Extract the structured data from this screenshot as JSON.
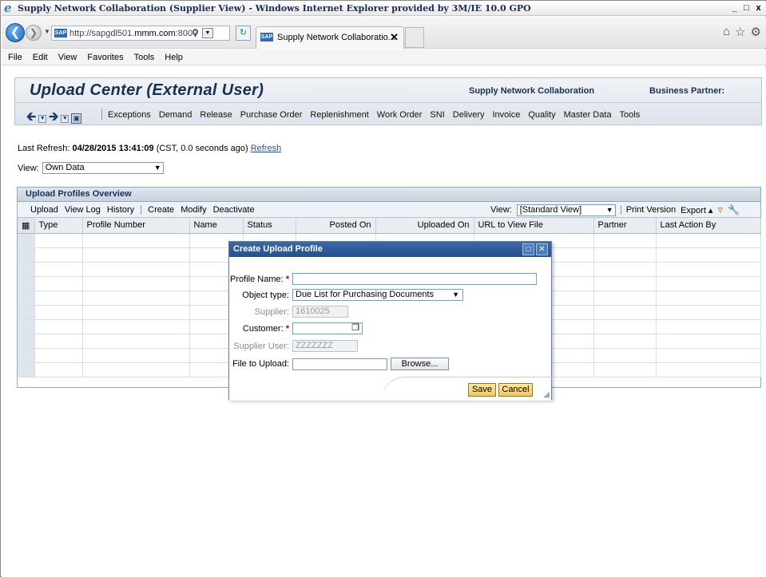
{
  "window": {
    "title": "Supply Network Collaboration (Supplier View) - Windows Internet Explorer provided by 3M/IE 10.0 GPO",
    "controls": [
      "_",
      "□",
      "x"
    ]
  },
  "browser": {
    "url_prefix": "http://sapgdl501.",
    "url_host": "mmm.com",
    "url_suffix": ":8000",
    "tab_label": "Supply Network Collaboratio...",
    "menu": [
      "File",
      "Edit",
      "View",
      "Favorites",
      "Tools",
      "Help"
    ]
  },
  "header": {
    "title": "Upload Center (External User)",
    "snc_label": "Supply Network Collaboration",
    "bp_label": "Business Partner:",
    "nav_items": [
      "Exceptions",
      "Demand",
      "Release",
      "Purchase Order",
      "Replenishment",
      "Work Order",
      "SNI",
      "Delivery",
      "Invoice",
      "Quality",
      "Master Data",
      "Tools"
    ]
  },
  "refresh": {
    "label": "Last Refresh:",
    "value": "04/28/2015 13:41:09",
    "detail": "(CST, 0.0 seconds ago)",
    "link": "Refresh"
  },
  "view": {
    "label": "View:",
    "value": "Own Data"
  },
  "panel": {
    "title": "Upload Profiles Overview",
    "toolbar_left": [
      "Upload",
      "View Log",
      "History"
    ],
    "toolbar_left2": [
      "Create",
      "Modify",
      "Deactivate"
    ],
    "view_label": "View:",
    "view_value": "[Standard View]",
    "print": "Print Version",
    "export": "Export",
    "columns": [
      "Type",
      "Profile Number",
      "Name",
      "Status",
      "Posted On",
      "Uploaded On",
      "URL to View File",
      "Partner",
      "Last Action By"
    ]
  },
  "dialog": {
    "title": "Create Upload Profile",
    "profile_name_label": "Profile Name:",
    "profile_name_value": "",
    "object_type_label": "Object type:",
    "object_type_value": "Due List for Purchasing Documents",
    "supplier_label": "Supplier:",
    "supplier_value": "1610025",
    "customer_label": "Customer:",
    "customer_value": "",
    "supplier_user_label": "Supplier User:",
    "supplier_user_value": "ZZZZZZZ",
    "file_label": "File to Upload:",
    "file_value": "",
    "browse": "Browse...",
    "save": "Save",
    "cancel": "Cancel",
    "required_mark": "*"
  }
}
